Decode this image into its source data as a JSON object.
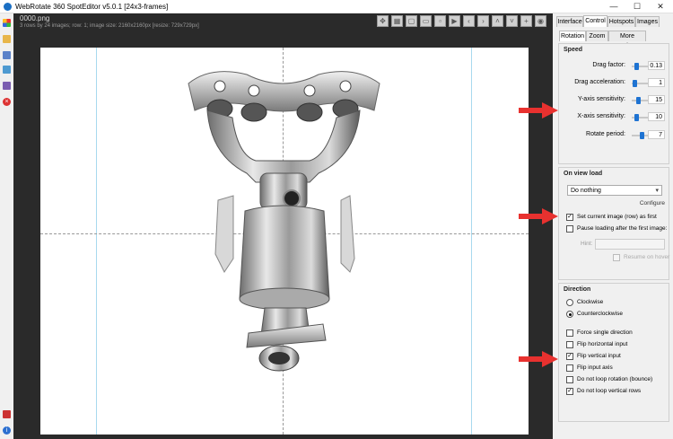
{
  "window": {
    "title": "WebRotate 360 SpotEditor v5.0.1 [24x3-frames]",
    "minimize": "—",
    "maximize": "☐",
    "close": "✕"
  },
  "canvas": {
    "filename": "0000.png",
    "info": "3 rows by 24 images; row: 1; image size: 2160x2160px [resize: 729x729px]"
  },
  "tabs": {
    "main": [
      "Interface",
      "Control",
      "Hotspots",
      "Images"
    ],
    "active_main": "Control",
    "sub": [
      "Rotation",
      "Zoom",
      "More Options"
    ],
    "active_sub": "Rotation"
  },
  "speed": {
    "title": "Speed",
    "sliders": [
      {
        "label": "Drag factor:",
        "value": "0.13",
        "level": 0.1
      },
      {
        "label": "Drag acceleration:",
        "value": "1",
        "level": 0.02
      },
      {
        "label": "Y-axis sensitivity:",
        "value": "15",
        "level": 0.15
      },
      {
        "label": "X-axis sensitivity:",
        "value": "10",
        "level": 0.1
      },
      {
        "label": "Rotate period:",
        "value": "7",
        "level": 0.3
      }
    ]
  },
  "view_load": {
    "title": "On view load",
    "select_value": "Do nothing",
    "configure_link": "Configure",
    "set_current_image": "Set current image (row) as first",
    "set_current_image_checked": true,
    "pause_loading": "Pause loading after the first image:",
    "pause_loading_checked": false,
    "hint_label": "Hint:",
    "hint_value": "",
    "resume_on_hover": "Resume on hover",
    "resume_on_hover_checked": false
  },
  "direction": {
    "title": "Direction",
    "clockwise": "Clockwise",
    "counterclockwise": "Counterclockwise",
    "selected": "Counterclockwise",
    "options": [
      {
        "label": "Force single direction",
        "checked": false
      },
      {
        "label": "Flip horizontal input",
        "checked": false
      },
      {
        "label": "Flip vertical input",
        "checked": true
      },
      {
        "label": "Flip input axis",
        "checked": false
      },
      {
        "label": "Do not loop rotation (bounce)",
        "checked": false
      },
      {
        "label": "Do not loop vertical rows",
        "checked": true
      }
    ]
  },
  "colors": {
    "accent": "#1e73d2",
    "annotation_arrow": "#e8312f",
    "canvas_bg": "#2a2a2a"
  },
  "icons": {
    "canvas_toolbar": [
      "move-icon",
      "grid-icon",
      "frame-icon",
      "frame-wide-icon",
      "frame-small-icon",
      "play-icon",
      "arrow-left-icon",
      "arrow-right-icon",
      "arrow-up-icon",
      "arrow-down-icon",
      "add-icon",
      "settings-icon"
    ]
  }
}
